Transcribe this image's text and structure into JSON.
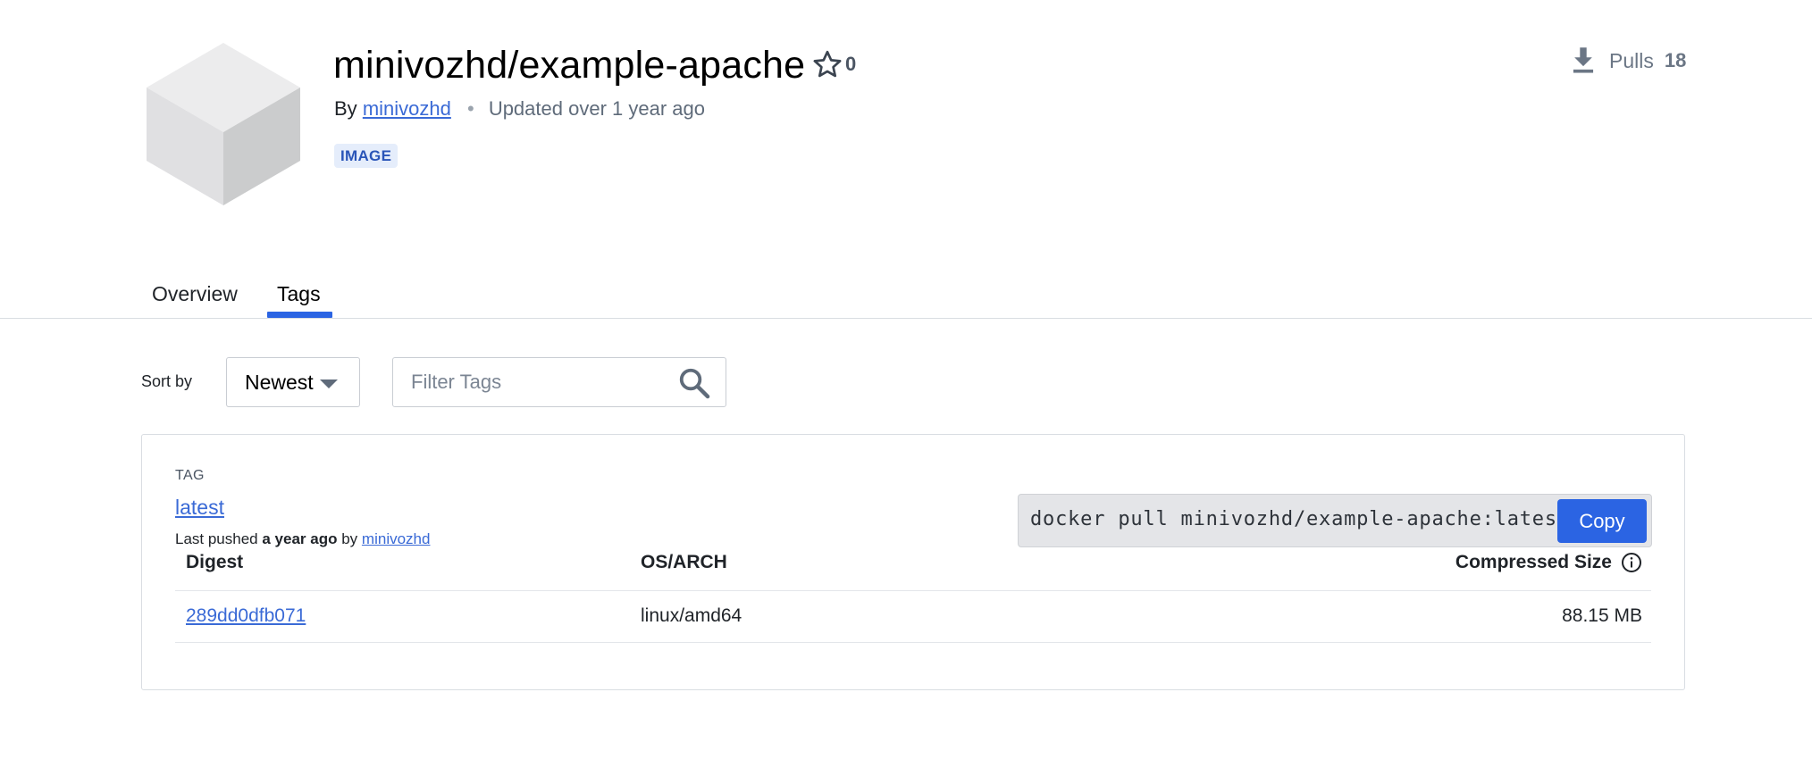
{
  "repo": {
    "title": "minivozhd/example-apache",
    "star_count": "0",
    "by_label": "By",
    "owner": "minivozhd",
    "separator": "•",
    "updated": "Updated over 1 year ago",
    "badge": "IMAGE",
    "pulls_label": "Pulls",
    "pulls_count": "18",
    "icons": [
      "cube-logo",
      "star-icon",
      "download-icon"
    ]
  },
  "tabs": [
    {
      "label": "Overview",
      "active": false
    },
    {
      "label": "Tags",
      "active": true
    }
  ],
  "controls": {
    "sort_label": "Sort by",
    "sort_value": "Newest",
    "filter_placeholder": "Filter Tags",
    "icons": [
      "chevron-down-icon",
      "search-icon"
    ]
  },
  "tag_card": {
    "caption": "TAG",
    "tag_name": "latest",
    "pushed_prefix": "Last pushed",
    "pushed_when": "a year ago",
    "pushed_by_label": "by",
    "pushed_by": "minivozhd",
    "pull_command": "docker pull minivozhd/example-apache:latest",
    "copy_label": "Copy",
    "columns": {
      "digest": "Digest",
      "os_arch": "OS/ARCH",
      "size": "Compressed Size"
    },
    "rows": [
      {
        "digest": "289dd0dfb071",
        "os_arch": "linux/amd64",
        "size": "88.15 MB"
      }
    ]
  },
  "colors": {
    "accent": "#2b64e3",
    "link": "#3a6ad6",
    "badge_bg": "#e5edfb",
    "badge_text": "#2a55b8",
    "border": "#d9dde2",
    "muted_text": "#6b7685"
  }
}
